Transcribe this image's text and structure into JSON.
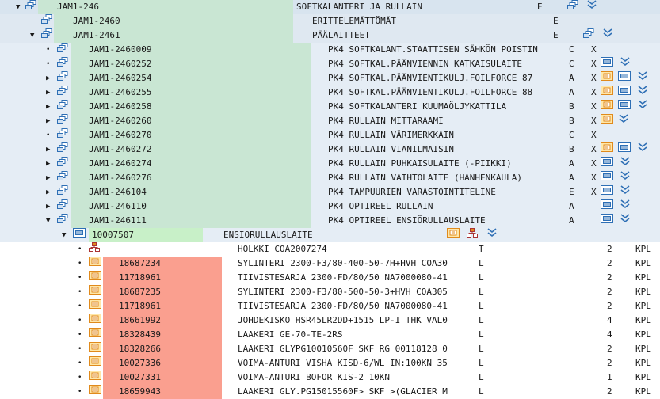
{
  "colors": {
    "green_highlight": "#c9e6d3",
    "bright_green": "#c8f0c8",
    "salmon": "#fa9f8f",
    "row_blue": "#e5edf5",
    "icon_blue": "#2e6fb5",
    "icon_orange": "#e08a1c"
  },
  "rows": [
    {
      "glyph": "▼",
      "code": "JAM1-246",
      "desc": "SOFTKALANTERI JA RULLAIN",
      "c1": "E",
      "c2": "",
      "icons": [
        "hierarchy-icon",
        "down-arrows-icon"
      ]
    },
    {
      "glyph": "",
      "code": "JAM1-2460",
      "desc": "ERITTELEMÄTTÖMÄT",
      "c1": "E",
      "c2": "",
      "icons": []
    },
    {
      "glyph": "▼",
      "code": "JAM1-2461",
      "desc": "PÄÄLAITTEET",
      "c1": "E",
      "c2": "",
      "icons": [
        "hierarchy-icon",
        "down-arrows-icon"
      ]
    },
    {
      "glyph": "•",
      "code": "JAM1-2460009",
      "desc": "PK4 SOFTKALANT.STAATTISEN SÄHKÖN POISTIN",
      "c1": "C",
      "c2": "X",
      "icons": []
    },
    {
      "glyph": "•",
      "code": "JAM1-2460252",
      "desc": "PK4 SOFTKAL.PÄÄNVIENNIN KATKAISULAITE",
      "c1": "C",
      "c2": "X",
      "icons": [
        "list-icon",
        "down-arrows-icon"
      ]
    },
    {
      "glyph": "▶",
      "code": "JAM1-2460254",
      "desc": "PK4 SOFTKAL.PÄÄNVIENTIKULJ.FOILFORCE 87",
      "c1": "A",
      "c2": "X",
      "icons": [
        "material-icon",
        "list-icon",
        "down-arrows-icon"
      ]
    },
    {
      "glyph": "▶",
      "code": "JAM1-2460255",
      "desc": "PK4 SOFTKAL.PÄÄNVIENTIKULJ.FOILFORCE 88",
      "c1": "A",
      "c2": "X",
      "icons": [
        "material-icon",
        "list-icon",
        "down-arrows-icon"
      ]
    },
    {
      "glyph": "▶",
      "code": "JAM1-2460258",
      "desc": "PK4 SOFTKALANTERI KUUMAÖLJYKATTILA",
      "c1": "B",
      "c2": "X",
      "icons": [
        "material-icon",
        "list-icon",
        "down-arrows-icon"
      ]
    },
    {
      "glyph": "▶",
      "code": "JAM1-2460260",
      "desc": "PK4 RULLAIN MITTARAAMI",
      "c1": "B",
      "c2": "X",
      "icons": [
        "material-icon",
        "down-arrows-icon"
      ]
    },
    {
      "glyph": "•",
      "code": "JAM1-2460270",
      "desc": "PK4 RULLAIN VÄRIMERKKAIN",
      "c1": "C",
      "c2": "X",
      "icons": []
    },
    {
      "glyph": "▶",
      "code": "JAM1-2460272",
      "desc": "PK4 RULLAIN VIANILMAISIN",
      "c1": "B",
      "c2": "X",
      "icons": [
        "material-icon",
        "list-icon",
        "down-arrows-icon"
      ]
    },
    {
      "glyph": "▶",
      "code": "JAM1-2460274",
      "desc": "PK4 RULLAIN PUHKAISULAITE (-PIIKKI)",
      "c1": "A",
      "c2": "X",
      "icons": [
        "list-icon",
        "down-arrows-icon"
      ]
    },
    {
      "glyph": "▶",
      "code": "JAM1-2460276",
      "desc": "PK4 RULLAIN VAIHTOLAITE (HANHENKAULA)",
      "c1": "A",
      "c2": "X",
      "icons": [
        "list-icon",
        "down-arrows-icon"
      ]
    },
    {
      "glyph": "▶",
      "code": "JAM1-246104",
      "desc": "PK4 TAMPUURIEN VARASTOINTITELINE",
      "c1": "E",
      "c2": "X",
      "icons": [
        "list-icon",
        "down-arrows-icon"
      ]
    },
    {
      "glyph": "▶",
      "code": "JAM1-246110",
      "desc": "PK4 OPTIREEL RULLAIN",
      "c1": "A",
      "c2": "",
      "icons": [
        "list-icon",
        "down-arrows-icon"
      ]
    },
    {
      "glyph": "▼",
      "code": "JAM1-246111",
      "desc": "PK4 OPTIREEL ENSIÖRULLAUSLAITE",
      "c1": "A",
      "c2": "",
      "icons": [
        "list-icon",
        "down-arrows-icon"
      ]
    }
  ],
  "subheader": {
    "glyph": "▼",
    "code": "10007507",
    "desc": "ENSIÖRULLAUSLAITE",
    "icons": [
      "material-icon",
      "hierarchy-orange-icon",
      "down-arrows-icon"
    ]
  },
  "items": [
    {
      "code": "",
      "desc": "HOLKKI COA2007274",
      "type": "T",
      "qty": "2",
      "unit": "KPL",
      "icon": "hierarchy-orange-icon"
    },
    {
      "code": "18687234",
      "desc": "SYLINTERI 2300-F3/80-400-50-7H+HVH COA30",
      "type": "L",
      "qty": "2",
      "unit": "KPL",
      "icon": "material-icon"
    },
    {
      "code": "11718961",
      "desc": "TIIVISTESARJA 2300-FD/80/50 NA7000080-41",
      "type": "L",
      "qty": "2",
      "unit": "KPL",
      "icon": "material-icon"
    },
    {
      "code": "18687235",
      "desc": "SYLINTERI 2300-F3/80-500-50-3+HVH COA305",
      "type": "L",
      "qty": "2",
      "unit": "KPL",
      "icon": "material-icon"
    },
    {
      "code": "11718961",
      "desc": "TIIVISTESARJA 2300-FD/80/50 NA7000080-41",
      "type": "L",
      "qty": "2",
      "unit": "KPL",
      "icon": "material-icon"
    },
    {
      "code": "18661992",
      "desc": "JOHDEKISKO HSR45LR2DD+1515 LP-I THK VAL0",
      "type": "L",
      "qty": "4",
      "unit": "KPL",
      "icon": "material-icon"
    },
    {
      "code": "18328439",
      "desc": "LAAKERI GE-70-TE-2RS",
      "type": "L",
      "qty": "4",
      "unit": "KPL",
      "icon": "material-icon"
    },
    {
      "code": "18328266",
      "desc": "LAAKERI GLYPG10010560F SKF RG 00118128 0",
      "type": "L",
      "qty": "2",
      "unit": "KPL",
      "icon": "material-icon"
    },
    {
      "code": "10027336",
      "desc": "VOIMA-ANTURI VISHA KISD-6/WL IN:100KN 35",
      "type": "L",
      "qty": "2",
      "unit": "KPL",
      "icon": "material-icon"
    },
    {
      "code": "10027331",
      "desc": "VOIMA-ANTURI BOFOR KIS-2 10KN",
      "type": "L",
      "qty": "1",
      "unit": "KPL",
      "icon": "material-icon"
    },
    {
      "code": "18659943",
      "desc": "LAAKERI GLY.PG15015560F> SKF >(GLACIER M",
      "type": "L",
      "qty": "2",
      "unit": "KPL",
      "icon": "material-icon"
    }
  ]
}
